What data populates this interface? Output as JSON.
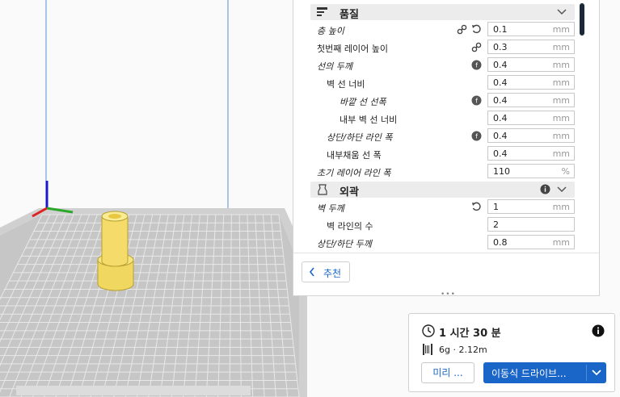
{
  "settings": {
    "quality": {
      "title": "품질",
      "rows": [
        {
          "label": "층 높이",
          "value": "0.1",
          "unit": "mm"
        },
        {
          "label": "첫번째 레이어 높이",
          "value": "0.3",
          "unit": "mm"
        },
        {
          "label": "선의 두께",
          "value": "0.4",
          "unit": "mm"
        },
        {
          "label": "벽 선 너비",
          "value": "0.4",
          "unit": "mm"
        },
        {
          "label": "바깥 선 선폭",
          "value": "0.4",
          "unit": "mm"
        },
        {
          "label": "내부 벽 선 너비",
          "value": "0.4",
          "unit": "mm"
        },
        {
          "label": "상단/하단 라인 폭",
          "value": "0.4",
          "unit": "mm"
        },
        {
          "label": "내부채움 선 폭",
          "value": "0.4",
          "unit": "mm"
        },
        {
          "label": "초기 레이어 라인 폭",
          "value": "110",
          "unit": "%"
        }
      ]
    },
    "shell": {
      "title": "외곽",
      "rows": [
        {
          "label": "벽 두께",
          "value": "1",
          "unit": "mm"
        },
        {
          "label": "벽 라인의 수",
          "value": "2",
          "unit": ""
        },
        {
          "label": "상단/하단 두께",
          "value": "0.8",
          "unit": "mm"
        }
      ]
    },
    "recommend_label": "추천"
  },
  "print": {
    "time": "1 시간 30 분",
    "material": "6g · 2.12m",
    "preview_label": "미리 ...",
    "save_label": "이동식 드라이브..."
  }
}
